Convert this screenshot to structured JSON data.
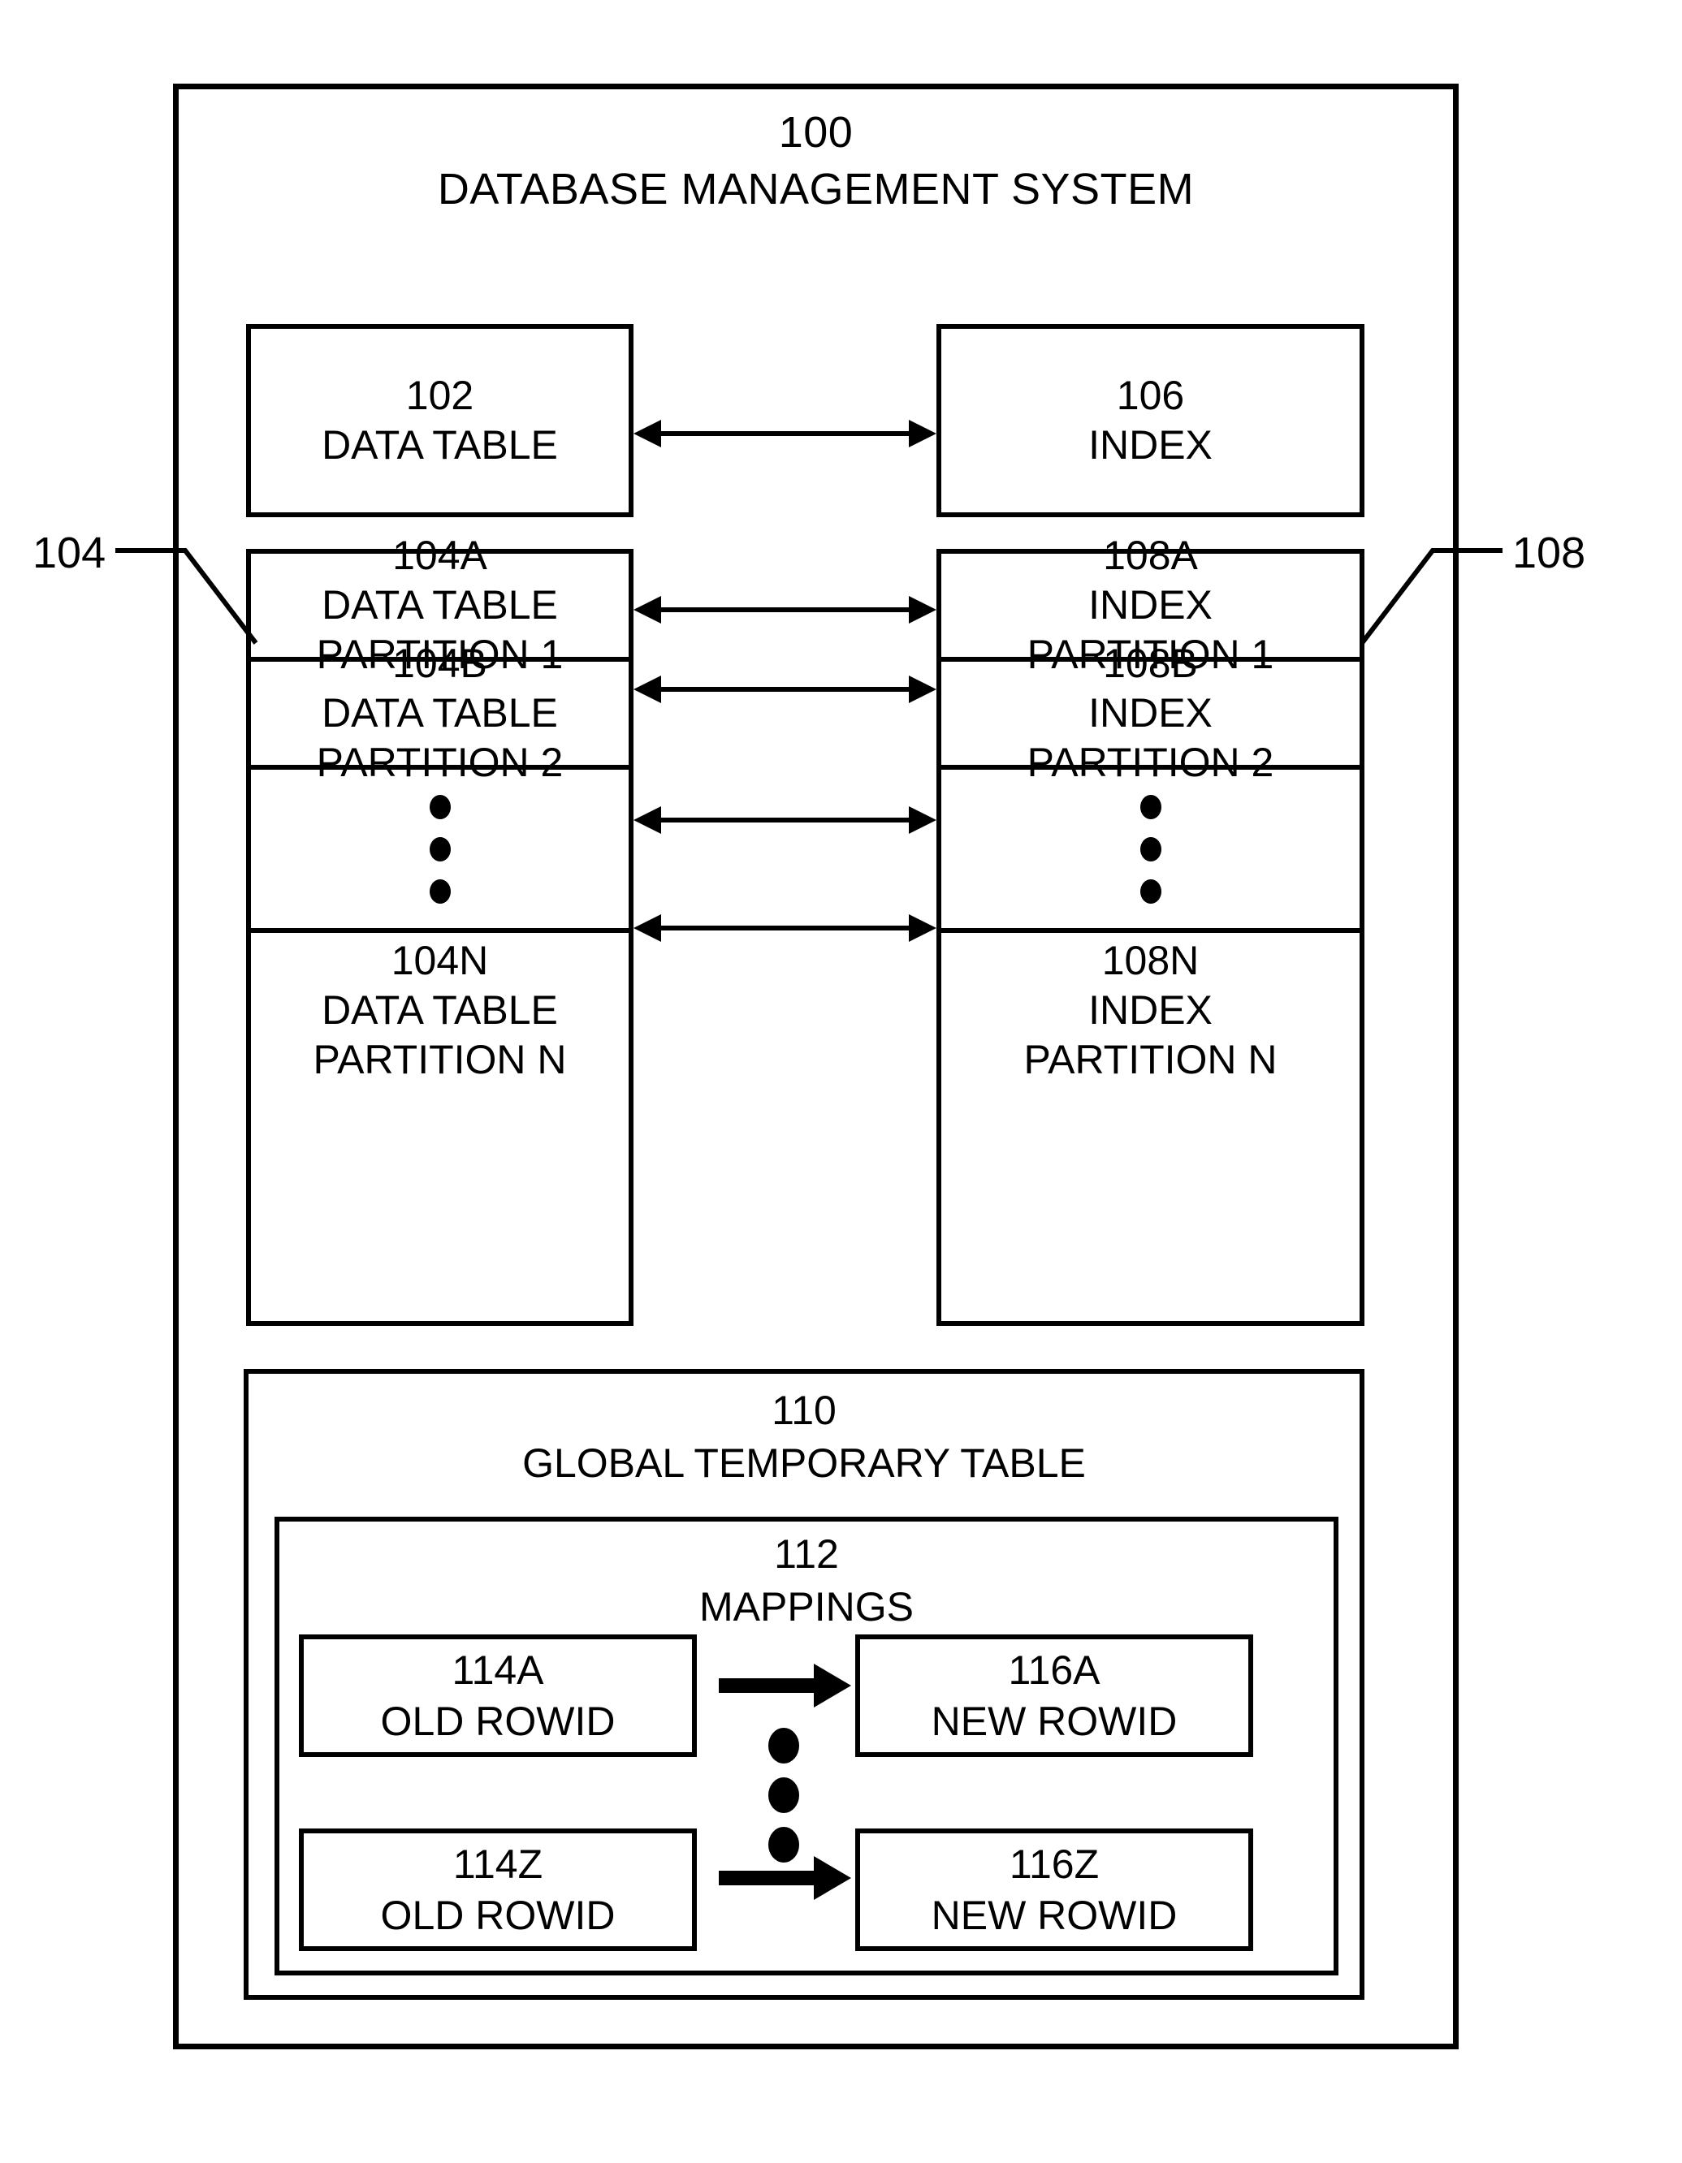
{
  "figure": {
    "system": {
      "ref": "100",
      "name": "DATABASE MANAGEMENT SYSTEM"
    },
    "data_table": {
      "ref": "102",
      "name": "DATA TABLE"
    },
    "index": {
      "ref": "106",
      "name": "INDEX"
    },
    "data_table_partitions_ref": "104",
    "index_partitions_ref": "108",
    "data_table_partitions": [
      {
        "ref": "104A",
        "line1": "DATA TABLE",
        "line2": "PARTITION 1"
      },
      {
        "ref": "104B",
        "line1": "DATA TABLE",
        "line2": "PARTITION 2"
      },
      {
        "ref": "",
        "line1": "",
        "line2": ""
      },
      {
        "ref": "104N",
        "line1": "DATA TABLE",
        "line2": "PARTITION N"
      }
    ],
    "index_partitions": [
      {
        "ref": "108A",
        "line1": "INDEX",
        "line2": "PARTITION 1"
      },
      {
        "ref": "108B",
        "line1": "INDEX",
        "line2": "PARTITION 2"
      },
      {
        "ref": "",
        "line1": "",
        "line2": ""
      },
      {
        "ref": "108N",
        "line1": "INDEX",
        "line2": "PARTITION N"
      }
    ],
    "global_temporary_table": {
      "ref": "110",
      "name": "GLOBAL TEMPORARY TABLE"
    },
    "mappings": {
      "ref": "112",
      "name": "MAPPINGS"
    },
    "mapping_rows": [
      {
        "old": {
          "ref": "114A",
          "name": "OLD ROWID"
        },
        "new": {
          "ref": "116A",
          "name": "NEW ROWID"
        }
      },
      {
        "old": {
          "ref": "114Z",
          "name": "OLD ROWID"
        },
        "new": {
          "ref": "116Z",
          "name": "NEW ROWID"
        }
      }
    ],
    "colors": {
      "ink": "#000000",
      "paper": "#ffffff"
    }
  }
}
